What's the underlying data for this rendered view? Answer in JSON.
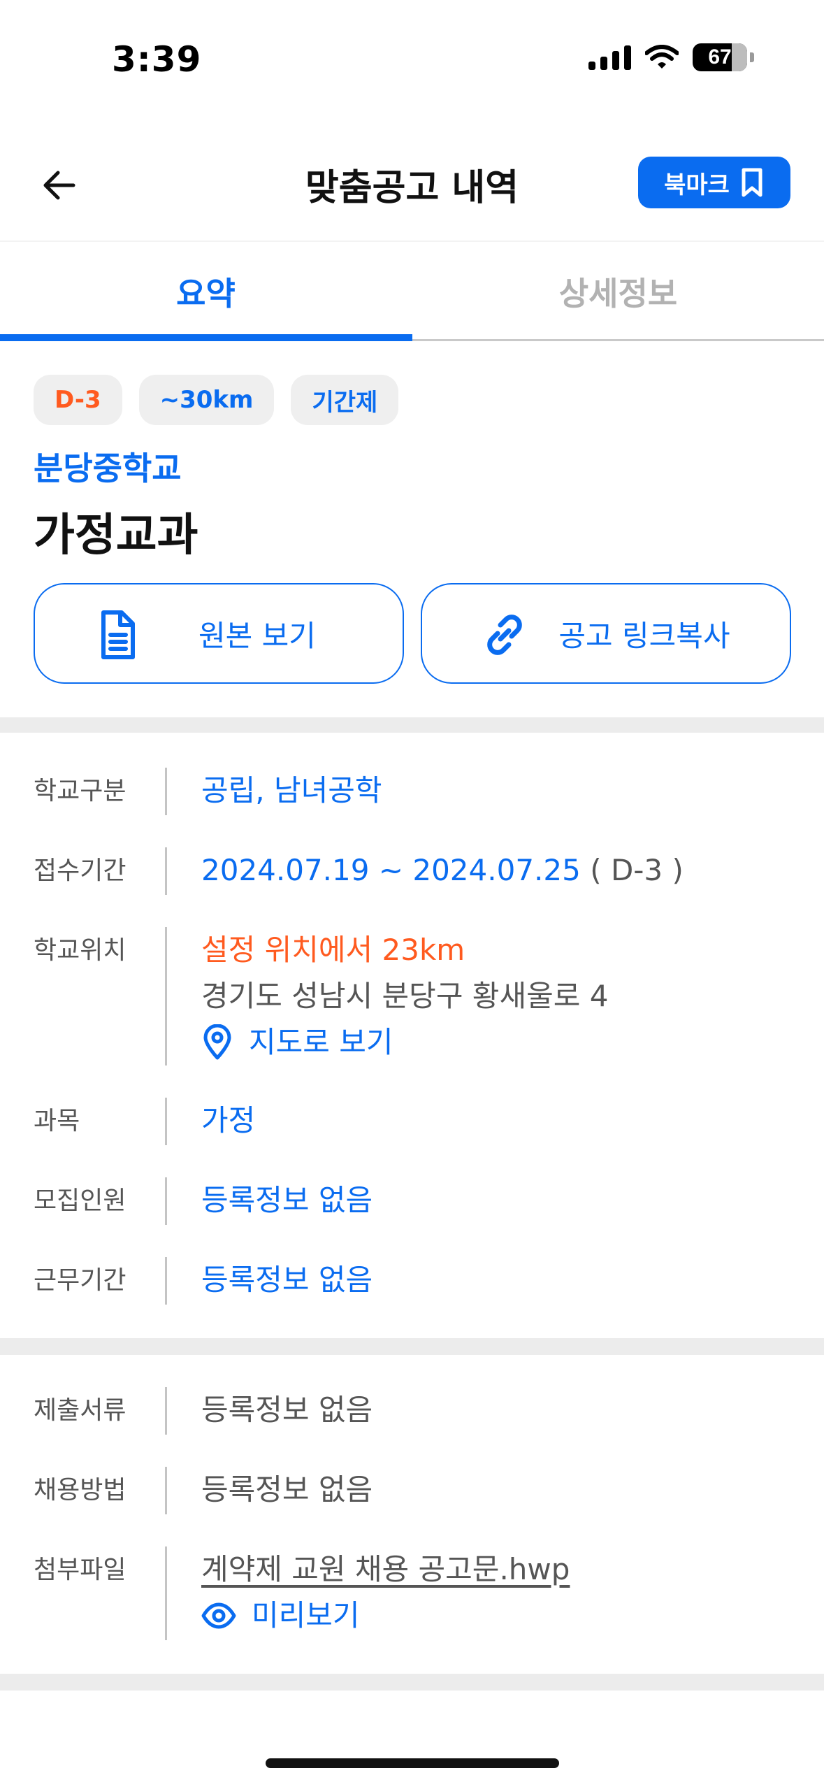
{
  "status": {
    "time": "3:39",
    "battery": "67"
  },
  "header": {
    "title": "맞춤공고 내역",
    "bookmark_label": "북마크"
  },
  "tabs": [
    {
      "label": "요약",
      "active": true
    },
    {
      "label": "상세정보",
      "active": false
    }
  ],
  "chips": [
    "D-3",
    "~30km",
    "기간제"
  ],
  "school_name": "분당중학교",
  "job_title": "가정교과",
  "actions": {
    "original": "원본 보기",
    "copy_link": "공고 링크복사"
  },
  "info": {
    "school_type": {
      "label": "학교구분",
      "value": "공립, 남녀공학"
    },
    "period": {
      "label": "접수기간",
      "value": "2024.07.19 ~ 2024.07.25",
      "dday": "( D-3 )"
    },
    "location": {
      "label": "학교위치",
      "distance": "설정 위치에서 23km",
      "address": "경기도 성남시 분당구 황새울로 4",
      "map_link": "지도로 보기"
    },
    "subject": {
      "label": "과목",
      "value": "가정"
    },
    "headcount": {
      "label": "모집인원",
      "value": "등록정보 없음"
    },
    "work_period": {
      "label": "근무기간",
      "value": "등록정보 없음"
    }
  },
  "docs": {
    "documents": {
      "label": "제출서류",
      "value": "등록정보 없음"
    },
    "method": {
      "label": "채용방법",
      "value": "등록정보 없음"
    },
    "attachment": {
      "label": "첨부파일",
      "file": "계약제 교원 채용 공고문.hwp",
      "preview": "미리보기"
    }
  },
  "colors": {
    "accent": "#0a6cf0",
    "warning": "#ff5a1f",
    "label": "#555555"
  }
}
